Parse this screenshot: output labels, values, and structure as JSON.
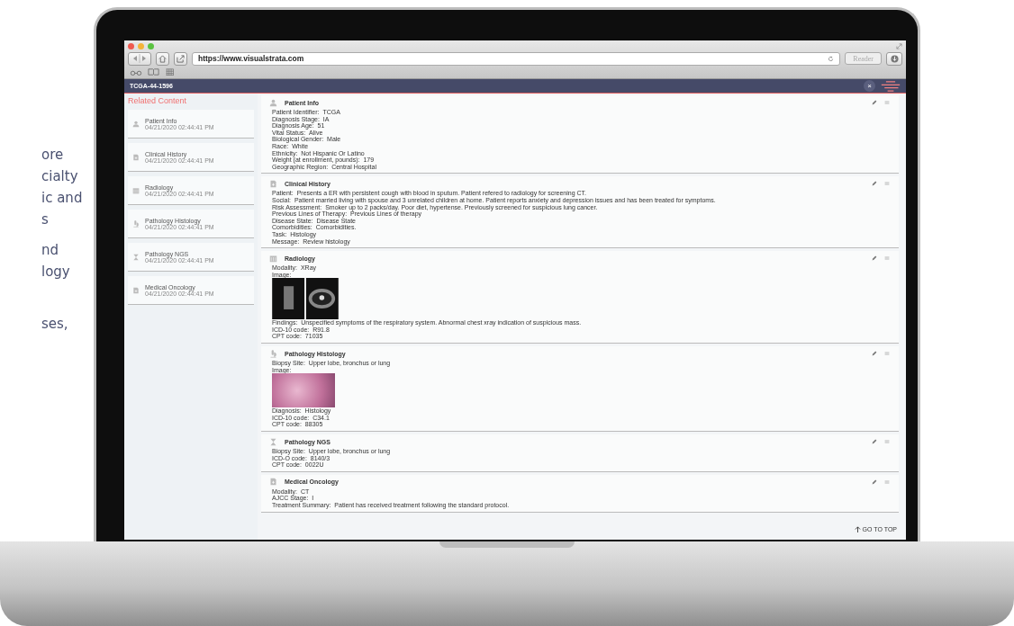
{
  "side_text": [
    [
      "ore",
      "cialty",
      "ic and",
      "s"
    ],
    [
      "nd",
      "logy"
    ],
    [
      "ses,"
    ]
  ],
  "browser": {
    "url": "https://www.visualstrata.com",
    "reader": "Reader"
  },
  "app": {
    "title": "TCGA-44-1596",
    "close": "×"
  },
  "sidebar": {
    "heading": "Related Content",
    "items": [
      {
        "kind": "person",
        "label": "Patient Info",
        "time": "04/21/2020 02:44:41 PM"
      },
      {
        "kind": "document",
        "label": "Clinical History",
        "time": "04/21/2020 02:44:41 PM"
      },
      {
        "kind": "building",
        "label": "Radiology",
        "time": "04/21/2020 02:44:41 PM"
      },
      {
        "kind": "microscope",
        "label": "Pathology Histology",
        "time": "04/21/2020 02:44:41 PM"
      },
      {
        "kind": "hourglass",
        "label": "Pathology NGS",
        "time": "04/21/2020 02:44:41 PM"
      },
      {
        "kind": "document",
        "label": "Medical Oncology",
        "time": "04/21/2020 02:44:41 PM"
      }
    ]
  },
  "cards": [
    {
      "kind": "person",
      "title": "Patient Info",
      "lines": [
        {
          "label": "Patient Identifier:",
          "value": "TCGA"
        },
        {
          "label": "Diagnosis Stage:",
          "value": "IA"
        },
        {
          "label": "Diagnosis Age:",
          "value": "51"
        },
        {
          "label": "Vital Status:",
          "value": "Alive"
        },
        {
          "label": "Biological Gender:",
          "value": "Male"
        },
        {
          "label": "Race:",
          "value": "White"
        },
        {
          "label": "Ethnicity:",
          "value": "Not Hispanic Or Latino"
        },
        {
          "label": "Weight (at enrollment, pounds):",
          "value": "179"
        },
        {
          "label": "Geographic Region:",
          "value": "Central Hospital"
        }
      ]
    },
    {
      "kind": "document",
      "title": "Clinical History",
      "lines": [
        {
          "label": "Patient:",
          "value": "Presents a ER with persistent cough with blood in sputum. Patient refered to radiology for screening CT."
        },
        {
          "label": "Social:",
          "value": "Patient married living with spouse and 3 unrelated children at home. Patient reports anxiety and depression issues and has been treated for symptoms."
        },
        {
          "label": "Risk Assessment:",
          "value": "Smoker up to 2 packs/day. Poor diet, hypertense. Previously screened for suspicious lung cancer."
        },
        {
          "label": "Previous Lines of Therapy:",
          "value": "Previous Lines of therapy"
        },
        {
          "label": "Disease State:",
          "value": "Disease State"
        },
        {
          "label": "Comorbidities:",
          "value": "Comorbidities."
        },
        {
          "label": "Task:",
          "value": "Histology"
        },
        {
          "label": "Message:",
          "value": "Review histology"
        }
      ]
    },
    {
      "kind": "building",
      "title": "Radiology",
      "lines": [
        {
          "label": "Modality:",
          "value": "XRay"
        },
        {
          "label": "Image:",
          "kind": "image"
        },
        {
          "label": "Findings:",
          "value": "Unspecified symptoms of the respiratory system. Abnormal chest xray indication of suspicious mass."
        },
        {
          "label": "ICD-10 code:",
          "value": "R91.8"
        },
        {
          "label": "CPT code:",
          "value": "71035"
        }
      ]
    },
    {
      "kind": "microscope",
      "title": "Pathology Histology",
      "lines": [
        {
          "label": "Biopsy Site:",
          "value": "Upper lobe, bronchus or lung"
        },
        {
          "label": "Image:",
          "kind": "image"
        },
        {
          "label": "Diagnosis:",
          "value": "Histology"
        },
        {
          "label": "ICD-10 code:",
          "value": "C34.1"
        },
        {
          "label": "CPT code:",
          "value": "88305"
        }
      ]
    },
    {
      "kind": "hourglass",
      "title": "Pathology NGS",
      "lines": [
        {
          "label": "Biopsy Site:",
          "value": "Upper lobe, bronchus or lung"
        },
        {
          "label": "ICD-O code:",
          "value": "8140/3"
        },
        {
          "label": "CPT code:",
          "value": "0022U"
        }
      ]
    },
    {
      "kind": "document",
      "title": "Medical Oncology",
      "lines": [
        {
          "label": "Modality:",
          "value": "CT"
        },
        {
          "label": "AJCC Stage:",
          "value": "I"
        },
        {
          "label": "Treatment Summary:",
          "value": "Patient has received treatment following the standard protocol."
        }
      ]
    }
  ],
  "go_to_top": "GO TO TOP"
}
